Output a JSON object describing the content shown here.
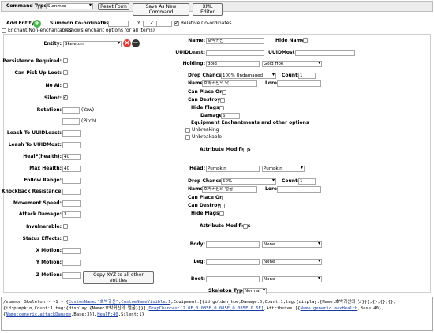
{
  "toolbar": {
    "command_type_label": "Command Type:",
    "command_type_value": "Summon",
    "reset_label": "Reset Form",
    "save_as_label": "Save As New Command",
    "xml_label": "XML Editor"
  },
  "entity_bar": {
    "add_entity_label": "Add Entity:",
    "summon_coords_label": "Summon Co-ordinates:",
    "x": "X",
    "y": "Y",
    "z": "Z",
    "relative_label": "Relative Co-ordinates",
    "enchant_label": "Enchant Non-enchantables",
    "enchant_note": "(Shows enchant options for all items)"
  },
  "left": {
    "entity_label": "Entity:",
    "entity_value": "Skeleton",
    "persistence": "Persistence Required:",
    "pickup": "Can Pick Up Loot:",
    "no_ai": "No AI:",
    "silent": "Silent:",
    "rotation": "Rotation:",
    "yaw": "(Yaw)",
    "pitch": "(Pitch)",
    "leash_least": "Leash To UUIDLeast:",
    "leash_most": "Leash To UUIDMost:",
    "healf": "HealF(health):",
    "healf_value": "40",
    "max_health": "Max Health:",
    "max_health_value": "40",
    "follow_range": "Follow Range:",
    "knockback": "Knockback Resistance:",
    "movement": "Movement Speed:",
    "attack": "Attack Damage:",
    "attack_value": "3",
    "invulnerable": "Invulnerable:",
    "status": "Status Effects:",
    "x_motion": "X Motion:",
    "y_motion": "Y Motion:",
    "z_motion": "Z Motion:",
    "copy_xyz": "Copy XYZ to all other entities"
  },
  "right": {
    "name_label": "Name:",
    "name_value": "호박귀신",
    "hide_name": "Hide Name:",
    "uuid_least": "UUIDLeast:",
    "uuid_most": "UUIDMost:",
    "holding_label": "Holding:",
    "holding_value": "gold",
    "holding_select": "Gold Hoe",
    "drop_chance": "Drop Chance:",
    "drop_select_1": "100% Undamaged",
    "count": "Count:",
    "count_1": "1",
    "item_name_label": "Name:",
    "item_name_1": "호박귀신의 낫",
    "lore": "Lore:",
    "can_place_on": "Can Place On:",
    "can_destroy": "Can Destroy:",
    "hide_flags": "Hide Flags:",
    "damage_label": "Damage:",
    "damage_value": "6",
    "equip_ench": "Equipment Enchantments and other options",
    "unbreaking": "Unbreaking",
    "unbreakable": "Unbreakable",
    "attr_mod": "Attribute Modifiers",
    "head_label": "Head:",
    "head_value": "Pumpkin",
    "head_select": "Pumpkin",
    "drop_select_2": "50%",
    "count_2": "1",
    "item_name_2": "호박귀신의 얼굴",
    "body_label": "Body:",
    "body_select": "None",
    "leg_label": "Leg:",
    "leg_select": "None",
    "boot_label": "Boot:",
    "boot_select": "None",
    "skeleton_type": "Skeleton Type:",
    "skeleton_type_value": "Normal"
  },
  "command": {
    "p1": "/summon Skeleton ~ ~1 ~ {",
    "p2": "CustomName:\"호박귀신\",CustomNameVisible:1",
    "p3": ",Equipment:[{id:golden_hoe,Damage:6,Count:1,tag:{display:{Name:호박귀신의 낫}}},{},{},{},",
    "p4": "{id:pumpkin,Count:1,tag:{display:{Name:호박귀신의 얼굴}}}],",
    "p5": "DropChances:[2.0F,0.085F,0.085F,0.085F,0.5F]",
    "p6": ",Attributes:[{",
    "p7": "Name:generic.maxHealth",
    "p8": ",Base:40},",
    "p9": "{",
    "p10": "Name:generic.attackDamage",
    "p11": ",Base:3}],",
    "p12": "HealF:40",
    "p13": ",Silent:1}"
  },
  "colors": {
    "add": "#45b649",
    "remove_red": "#e53935",
    "remove_dark": "#333333",
    "link": "#1a3ea8"
  }
}
